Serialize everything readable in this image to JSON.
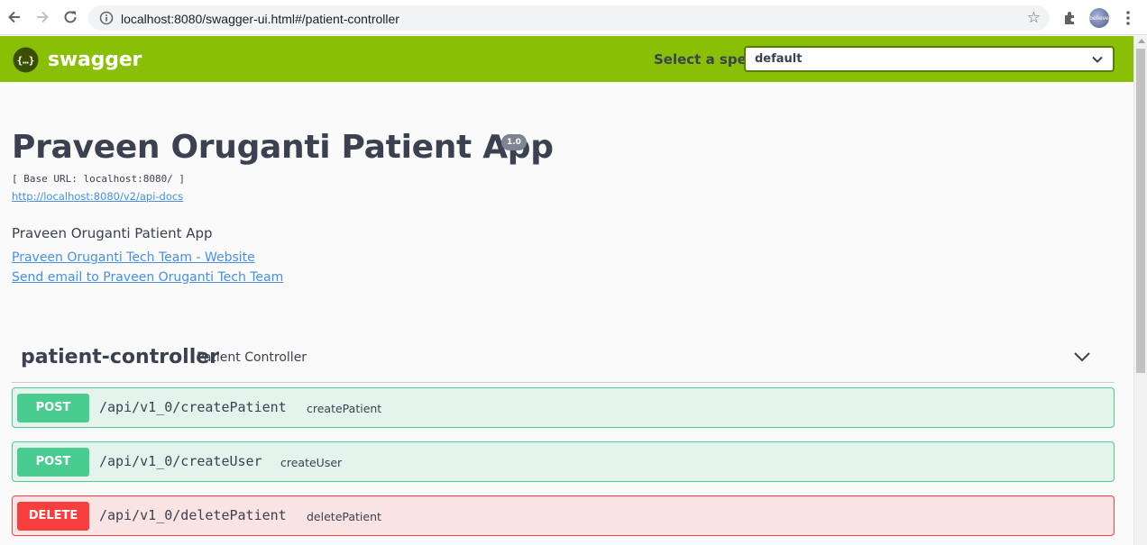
{
  "browser": {
    "url": "localhost:8080/swagger-ui.html#/patient-controller",
    "avatar_text": "believe"
  },
  "topbar": {
    "logo_text": "swagger",
    "spec_label": "Select a spec",
    "spec_value": "default"
  },
  "info": {
    "title": "Praveen Oruganti Patient App",
    "version": "1.0",
    "base_url": "[ Base URL: localhost:8080/ ]",
    "api_docs_link": "http://localhost:8080/v2/api-docs",
    "description": "Praveen Oruganti Patient App",
    "website_link": "Praveen Oruganti Tech Team - Website",
    "email_link": "Send email to Praveen Oruganti Tech Team"
  },
  "tag": {
    "name": "patient-controller",
    "description": "Patient Controller"
  },
  "operations": [
    {
      "method": "POST",
      "path": "/api/v1_0/createPatient",
      "summary": "createPatient"
    },
    {
      "method": "POST",
      "path": "/api/v1_0/createUser",
      "summary": "createUser"
    },
    {
      "method": "DELETE",
      "path": "/api/v1_0/deletePatient",
      "summary": "deletePatient"
    }
  ],
  "colors": {
    "topbar": "#89bf04",
    "post": "#49cc90",
    "delete": "#f93e3e",
    "link": "#4990e2"
  }
}
